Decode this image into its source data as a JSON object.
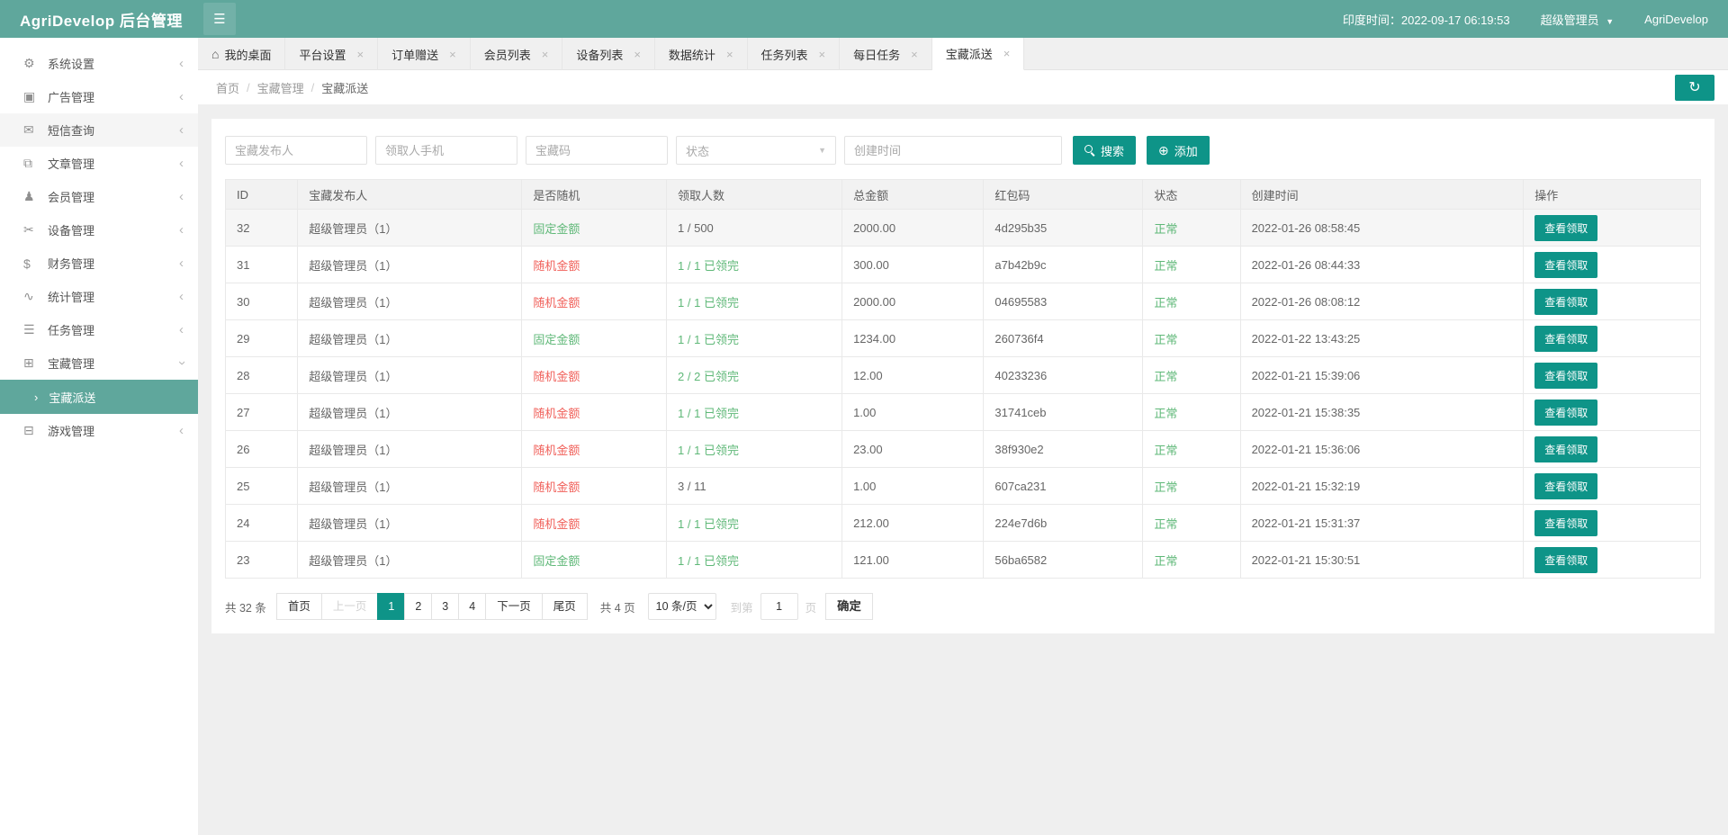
{
  "header": {
    "logo": "AgriDevelop 后台管理",
    "time": "印度时间：2022-09-17 06:19:53",
    "user": "超级管理员",
    "brand": "AgriDevelop"
  },
  "icons": {
    "burger": "☰",
    "home": "⌂",
    "close": "×",
    "caret": "▼",
    "refresh": "↻",
    "add": "⊕",
    "collapse": "‹",
    "submenu_arrow": "›",
    "select_caret": "▼"
  },
  "sidebar": {
    "items": [
      {
        "name": "system-settings",
        "icon": "gear-icon",
        "glyph": "⚙",
        "label": "系统设置"
      },
      {
        "name": "ad-management",
        "icon": "image-icon",
        "glyph": "▣",
        "label": "广告管理"
      },
      {
        "name": "sms-query",
        "icon": "mail-icon",
        "glyph": "✉",
        "label": "短信查询",
        "highlight": true
      },
      {
        "name": "article-management",
        "icon": "book-icon",
        "glyph": "⧉",
        "label": "文章管理"
      },
      {
        "name": "member-management",
        "icon": "user-icon",
        "glyph": "♟",
        "label": "会员管理"
      },
      {
        "name": "device-management",
        "icon": "tools-icon",
        "glyph": "✂",
        "label": "设备管理"
      },
      {
        "name": "finance-management",
        "icon": "dollar-icon",
        "glyph": "$",
        "label": "财务管理"
      },
      {
        "name": "stats-management",
        "icon": "pulse-icon",
        "glyph": "∿",
        "label": "统计管理"
      },
      {
        "name": "task-management",
        "icon": "sliders-icon",
        "glyph": "☰",
        "label": "任务管理"
      },
      {
        "name": "treasure-management",
        "icon": "gift-icon",
        "glyph": "⊞",
        "label": "宝藏管理",
        "expanded": true,
        "children": [
          {
            "name": "treasure-delivery",
            "label": "宝藏派送",
            "active": true
          }
        ]
      },
      {
        "name": "game-management",
        "icon": "game-icon",
        "glyph": "⊟",
        "label": "游戏管理"
      }
    ]
  },
  "tabs": [
    {
      "name": "my-desktop",
      "label": "我的桌面",
      "home": true
    },
    {
      "name": "platform-settings",
      "label": "平台设置",
      "closable": true
    },
    {
      "name": "order-gift",
      "label": "订单赠送",
      "closable": true
    },
    {
      "name": "member-list",
      "label": "会员列表",
      "closable": true
    },
    {
      "name": "device-list",
      "label": "设备列表",
      "closable": true
    },
    {
      "name": "data-stats",
      "label": "数据统计",
      "closable": true
    },
    {
      "name": "task-list",
      "label": "任务列表",
      "closable": true
    },
    {
      "name": "daily-task",
      "label": "每日任务",
      "closable": true
    },
    {
      "name": "treasure-delivery",
      "label": "宝藏派送",
      "closable": true,
      "active": true
    }
  ],
  "breadcrumb": [
    "首页",
    "宝藏管理",
    "宝藏派送"
  ],
  "filters": {
    "inputs": [
      "宝藏发布人",
      "领取人手机",
      "宝藏码"
    ],
    "select_placeholder": "状态",
    "date_placeholder": "创建时间",
    "search_label": "搜索",
    "add_label": "添加"
  },
  "table": {
    "columns": [
      {
        "label": "ID",
        "width": "4.9%"
      },
      {
        "label": "宝藏发布人",
        "width": "15.2%"
      },
      {
        "label": "是否随机",
        "width": "9.8%"
      },
      {
        "label": "领取人数",
        "width": "11.9%"
      },
      {
        "label": "总金额",
        "width": "9.6%"
      },
      {
        "label": "红包码",
        "width": "10.8%"
      },
      {
        "label": "状态",
        "width": "6.6%"
      },
      {
        "label": "创建时间",
        "width": "19.2%"
      },
      {
        "label": "操作",
        "width": "12.0%"
      }
    ],
    "action_label": "查看领取",
    "rows": [
      {
        "id": "32",
        "publisher": "超级管理员（1）",
        "random": "固定金额",
        "random_type": "fixed",
        "claim": "1 / 500",
        "claim_full": false,
        "amount": "2000.00",
        "code": "4d295b35",
        "status": "正常",
        "created": "2022-01-26 08:58:45",
        "highlight": true
      },
      {
        "id": "31",
        "publisher": "超级管理员（1）",
        "random": "随机金额",
        "random_type": "random",
        "claim": "1 / 1 已领完",
        "claim_full": true,
        "amount": "300.00",
        "code": "a7b42b9c",
        "status": "正常",
        "created": "2022-01-26 08:44:33"
      },
      {
        "id": "30",
        "publisher": "超级管理员（1）",
        "random": "随机金额",
        "random_type": "random",
        "claim": "1 / 1 已领完",
        "claim_full": true,
        "amount": "2000.00",
        "code": "04695583",
        "status": "正常",
        "created": "2022-01-26 08:08:12"
      },
      {
        "id": "29",
        "publisher": "超级管理员（1）",
        "random": "固定金额",
        "random_type": "fixed",
        "claim": "1 / 1 已领完",
        "claim_full": true,
        "amount": "1234.00",
        "code": "260736f4",
        "status": "正常",
        "created": "2022-01-22 13:43:25"
      },
      {
        "id": "28",
        "publisher": "超级管理员（1）",
        "random": "随机金额",
        "random_type": "random",
        "claim": "2 / 2 已领完",
        "claim_full": true,
        "amount": "12.00",
        "code": "40233236",
        "status": "正常",
        "created": "2022-01-21 15:39:06"
      },
      {
        "id": "27",
        "publisher": "超级管理员（1）",
        "random": "随机金额",
        "random_type": "random",
        "claim": "1 / 1 已领完",
        "claim_full": true,
        "amount": "1.00",
        "code": "31741ceb",
        "status": "正常",
        "created": "2022-01-21 15:38:35"
      },
      {
        "id": "26",
        "publisher": "超级管理员（1）",
        "random": "随机金额",
        "random_type": "random",
        "claim": "1 / 1 已领完",
        "claim_full": true,
        "amount": "23.00",
        "code": "38f930e2",
        "status": "正常",
        "created": "2022-01-21 15:36:06"
      },
      {
        "id": "25",
        "publisher": "超级管理员（1）",
        "random": "随机金额",
        "random_type": "random",
        "claim": "3 / 11",
        "claim_full": false,
        "amount": "1.00",
        "code": "607ca231",
        "status": "正常",
        "created": "2022-01-21 15:32:19"
      },
      {
        "id": "24",
        "publisher": "超级管理员（1）",
        "random": "随机金额",
        "random_type": "random",
        "claim": "1 / 1 已领完",
        "claim_full": true,
        "amount": "212.00",
        "code": "224e7d6b",
        "status": "正常",
        "created": "2022-01-21 15:31:37"
      },
      {
        "id": "23",
        "publisher": "超级管理员（1）",
        "random": "固定金额",
        "random_type": "fixed",
        "claim": "1 / 1 已领完",
        "claim_full": true,
        "amount": "121.00",
        "code": "56ba6582",
        "status": "正常",
        "created": "2022-01-21 15:30:51"
      }
    ]
  },
  "pagination": {
    "total": "共 32 条",
    "buttons": [
      {
        "label": "首页"
      },
      {
        "label": "上一页",
        "disabled": true
      },
      {
        "label": "1",
        "active": true,
        "num": true
      },
      {
        "label": "2",
        "num": true
      },
      {
        "label": "3",
        "num": true
      },
      {
        "label": "4",
        "num": true
      },
      {
        "label": "下一页"
      },
      {
        "label": "尾页"
      }
    ],
    "page_count": "共 4 页",
    "per_page": "10 条/页",
    "goto_prefix": "到第",
    "goto_value": "1",
    "goto_suffix": "页",
    "confirm": "确定"
  },
  "colors": {
    "header_teal": "#5fa79c",
    "button_teal": "#0e9488",
    "green": "#5fb878",
    "red": "#f0605a"
  }
}
